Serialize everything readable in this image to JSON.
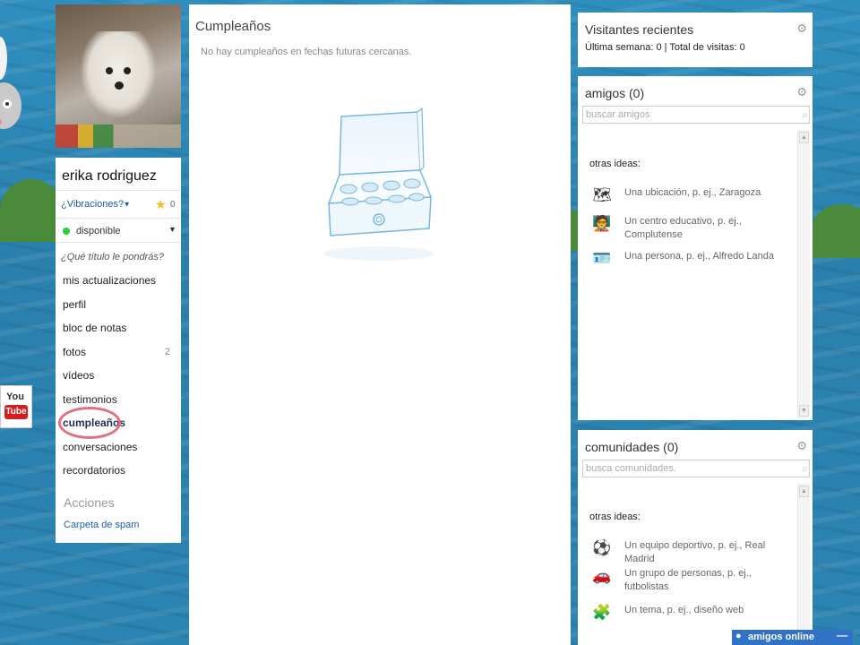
{
  "profile": {
    "name": "erika rodriguez",
    "vibes_label": "¿Vibraciones?",
    "stars_count": "0",
    "status": "disponible",
    "title_prompt": "¿Qué título le pondrás?",
    "menu": [
      {
        "label": "mis actualizaciones",
        "count": ""
      },
      {
        "label": "perfil",
        "count": ""
      },
      {
        "label": "bloc de notas",
        "count": ""
      },
      {
        "label": "fotos",
        "count": "2"
      },
      {
        "label": "vídeos",
        "count": ""
      },
      {
        "label": "testimonios",
        "count": ""
      },
      {
        "label": "cumpleaños",
        "count": ""
      },
      {
        "label": "conversaciones",
        "count": ""
      },
      {
        "label": "recordatorios",
        "count": ""
      }
    ],
    "active_item": "cumpleaños",
    "actions_heading": "Acciones",
    "spam_link": "Carpeta de spam"
  },
  "center": {
    "title": "Cumpleaños",
    "message": "No hay cumpleaños en fechas futuras cercanas."
  },
  "visitors": {
    "title": "Visitantes recientes",
    "summary": "Última semana: 0 | Total de visitas: 0"
  },
  "friends": {
    "title": "amigos (0)",
    "search_placeholder": "buscar amigos",
    "ideas_heading": "otras ideas:",
    "ideas": [
      {
        "text": "Una ubicación, p. ej., Zaragoza",
        "icon": "map-icon"
      },
      {
        "text": "Un centro educativo, p. ej., Complutense",
        "icon": "blackboard-icon"
      },
      {
        "text": "Una persona, p. ej., Alfredo Landa",
        "icon": "id-card-icon"
      }
    ]
  },
  "communities": {
    "title": "comunidades (0)",
    "search_placeholder": "busca comunidades.",
    "ideas_heading": "otras ideas:",
    "ideas": [
      {
        "text": "Un equipo deportivo, p. ej., Real Madrid",
        "icon": "soccer-ball-icon"
      },
      {
        "text": "Un grupo de personas, p. ej., futbolistas",
        "icon": "car-icon"
      },
      {
        "text": "Un tema, p. ej., diseño web",
        "icon": "puzzle-icon"
      }
    ]
  },
  "youtube": {
    "top": "You",
    "bottom": "Tube"
  },
  "chat": {
    "label": "amigos online",
    "minimize": "—"
  }
}
